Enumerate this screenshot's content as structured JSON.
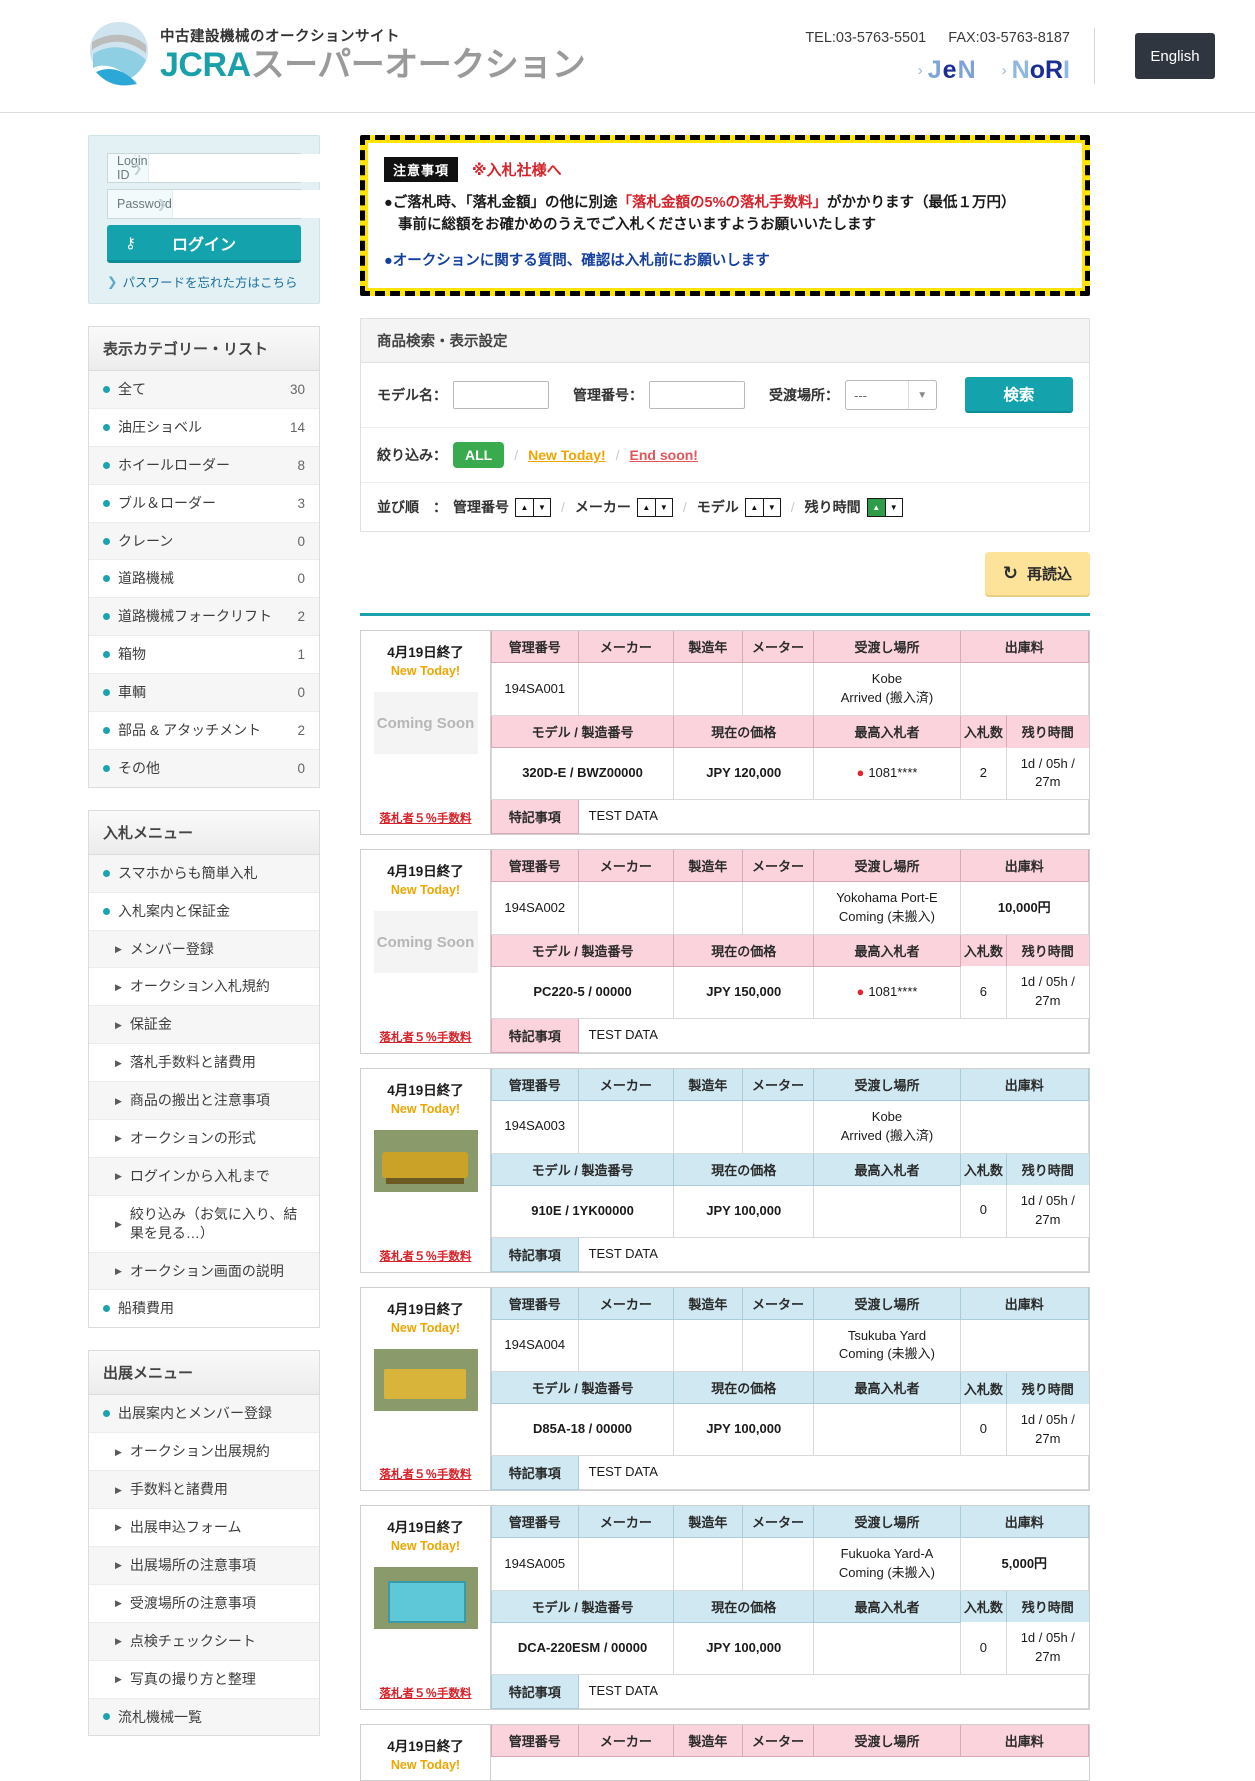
{
  "header": {
    "logo_tagline": "中古建設機械のオークションサイト",
    "logo_jcra": "JCRA",
    "logo_super_auction": "スーパーオークション",
    "tel": "TEL:03-5763-5501",
    "fax": "FAX:03-5763-8187",
    "partner_jen": "JeN",
    "partner_nori": "NoRI",
    "english_button": "English"
  },
  "login": {
    "id_label": "Login ID",
    "id_value": "",
    "password_label": "Password",
    "password_value": "",
    "login_button": "ログイン",
    "forgot_link": "パスワードを忘れた方はこちら"
  },
  "category_panel": {
    "title": "表示カテゴリー・リスト",
    "items": [
      {
        "label": "全て",
        "count": "30"
      },
      {
        "label": "油圧ショベル",
        "count": "14"
      },
      {
        "label": "ホイールローダー",
        "count": "8"
      },
      {
        "label": "ブル＆ローダー",
        "count": "3"
      },
      {
        "label": "クレーン",
        "count": "0"
      },
      {
        "label": "道路機械",
        "count": "0"
      },
      {
        "label": "道路機械フォークリフト",
        "count": "2"
      },
      {
        "label": "箱物",
        "count": "1"
      },
      {
        "label": "車輌",
        "count": "0"
      },
      {
        "label": "部品 & アタッチメント",
        "count": "2"
      },
      {
        "label": "その他",
        "count": "0"
      }
    ]
  },
  "bid_menu": {
    "title": "入札メニュー",
    "items": [
      {
        "label": "スマホからも簡単入札",
        "sub": false
      },
      {
        "label": "入札案内と保証金",
        "sub": false
      },
      {
        "label": "メンバー登録",
        "sub": true
      },
      {
        "label": "オークション入札規約",
        "sub": true
      },
      {
        "label": "保証金",
        "sub": true
      },
      {
        "label": "落札手数料と諸費用",
        "sub": true
      },
      {
        "label": "商品の搬出と注意事項",
        "sub": true
      },
      {
        "label": "オークションの形式",
        "sub": true
      },
      {
        "label": "ログインから入札まで",
        "sub": true
      },
      {
        "label": "絞り込み（お気に入り、結果を見る…）",
        "sub": true
      },
      {
        "label": "オークション画面の説明",
        "sub": true
      },
      {
        "label": "船積費用",
        "sub": false
      }
    ]
  },
  "exhibit_menu": {
    "title": "出展メニュー",
    "items": [
      {
        "label": "出展案内とメンバー登録",
        "sub": false
      },
      {
        "label": "オークション出展規約",
        "sub": true
      },
      {
        "label": "手数料と諸費用",
        "sub": true
      },
      {
        "label": "出展申込フォーム",
        "sub": true
      },
      {
        "label": "出展場所の注意事項",
        "sub": true
      },
      {
        "label": "受渡場所の注意事項",
        "sub": true
      },
      {
        "label": "点検チェックシート",
        "sub": true
      },
      {
        "label": "写真の撮り方と整理",
        "sub": true
      },
      {
        "label": "流札機械一覧",
        "sub": false
      }
    ]
  },
  "notice": {
    "badge": "注意事項",
    "to_bidders": "※入札社様へ",
    "line1_pre": "●ご落札時、「落札金額」の他に別途",
    "line1_hl": "「落札金額の5%の落札手数料」",
    "line1_post": "がかかります（最低１万円）",
    "line1_second": "事前に総額をお確かめのうえでご入札くださいますようお願いいたします",
    "line2": "●オークションに関する質問、確認は入札前にお願いします"
  },
  "search": {
    "panel_title": "商品検索・表示設定",
    "model_label": "モデル名：",
    "model_value": "",
    "control_no_label": "管理番号：",
    "control_no_value": "",
    "location_label": "受渡場所：",
    "location_value": "---",
    "search_button": "検索",
    "filter_label": "絞り込み：",
    "filter_all": "ALL",
    "filter_new_today": "New Today!",
    "filter_end_soon": "End soon!",
    "sort_label": "並び順　：",
    "sort_options": [
      {
        "label": "管理番号",
        "active": "none"
      },
      {
        "label": "メーカー",
        "active": "none"
      },
      {
        "label": "モデル",
        "active": "none"
      },
      {
        "label": "残り時間",
        "active": "up"
      }
    ],
    "arrow_up": "▲",
    "arrow_down": "▼"
  },
  "reload_button": "再読込",
  "table_headers": {
    "control_no": "管理番号",
    "maker": "メーカー",
    "year": "製造年",
    "meter": "メーター",
    "delivery_place": "受渡し場所",
    "shipout_fee": "出庫料",
    "model_serial": "モデル / 製造番号",
    "current_price": "現在の価格",
    "top_bidder": "最高入札者",
    "bid_count": "入札数",
    "time_left": "残り時間",
    "remarks": "特記事項"
  },
  "fee_note": "落札者５％手数料",
  "items": [
    {
      "end_date": "4月19日終了",
      "new_today": "New Today!",
      "thumb_text": "Coming Soon",
      "thumb_type": "text",
      "control_no": "194SA001",
      "maker": "",
      "year": "",
      "meter": "",
      "delivery_place": "Kobe\nArrived (搬入済)",
      "shipout_fee": "",
      "model_serial": "320D-E / BWZ00000",
      "current_price": "JPY 120,000",
      "top_bidder": "1081****",
      "has_bidder": true,
      "bid_count": "2",
      "time_left": "1d / 05h / 27m",
      "remarks": "TEST DATA",
      "header_color": "pink"
    },
    {
      "end_date": "4月19日終了",
      "new_today": "New Today!",
      "thumb_text": "Coming Soon",
      "thumb_type": "text",
      "control_no": "194SA002",
      "maker": "",
      "year": "",
      "meter": "",
      "delivery_place": "Yokohama Port-E\nComing (未搬入)",
      "shipout_fee": "10,000円",
      "model_serial": "PC220-5 / 00000",
      "current_price": "JPY 150,000",
      "top_bidder": "1081****",
      "has_bidder": true,
      "bid_count": "6",
      "time_left": "1d / 05h / 27m",
      "remarks": "TEST DATA",
      "header_color": "pink"
    },
    {
      "end_date": "4月19日終了",
      "new_today": "New Today!",
      "thumb_text": "",
      "thumb_type": "grader",
      "control_no": "194SA003",
      "maker": "",
      "year": "",
      "meter": "",
      "delivery_place": "Kobe\nArrived (搬入済)",
      "shipout_fee": "",
      "model_serial": "910E / 1YK00000",
      "current_price": "JPY 100,000",
      "top_bidder": "",
      "has_bidder": false,
      "bid_count": "0",
      "time_left": "1d / 05h / 27m",
      "remarks": "TEST DATA",
      "header_color": "blue"
    },
    {
      "end_date": "4月19日終了",
      "new_today": "New Today!",
      "thumb_text": "",
      "thumb_type": "dozer",
      "control_no": "194SA004",
      "maker": "",
      "year": "",
      "meter": "",
      "delivery_place": "Tsukuba Yard\nComing (未搬入)",
      "shipout_fee": "",
      "model_serial": "D85A-18 / 00000",
      "current_price": "JPY 100,000",
      "top_bidder": "",
      "has_bidder": false,
      "bid_count": "0",
      "time_left": "1d / 05h / 27m",
      "remarks": "TEST DATA",
      "header_color": "blue"
    },
    {
      "end_date": "4月19日終了",
      "new_today": "New Today!",
      "thumb_text": "",
      "thumb_type": "gen",
      "control_no": "194SA005",
      "maker": "",
      "year": "",
      "meter": "",
      "delivery_place": "Fukuoka Yard-A\nComing (未搬入)",
      "shipout_fee": "5,000円",
      "model_serial": "DCA-220ESM / 00000",
      "current_price": "JPY 100,000",
      "top_bidder": "",
      "has_bidder": false,
      "bid_count": "0",
      "time_left": "1d / 05h / 27m",
      "remarks": "TEST DATA",
      "header_color": "blue"
    },
    {
      "end_date": "4月19日終了",
      "new_today": "New Today!",
      "thumb_text": "",
      "thumb_type": "none",
      "control_no": "",
      "maker": "",
      "year": "",
      "meter": "",
      "delivery_place": "",
      "shipout_fee": "",
      "model_serial": "",
      "current_price": "",
      "top_bidder": "",
      "has_bidder": false,
      "bid_count": "",
      "time_left": "",
      "remarks": "",
      "header_color": "pink",
      "partial": true
    }
  ],
  "colors": {
    "teal": "#14a2ad",
    "pink_header": "#fbd3dd",
    "blue_header": "#cfe8f2",
    "green": "#3aaa4f",
    "yellow": "#ffe400",
    "orange": "#f0a500",
    "red": "#d8222a"
  }
}
